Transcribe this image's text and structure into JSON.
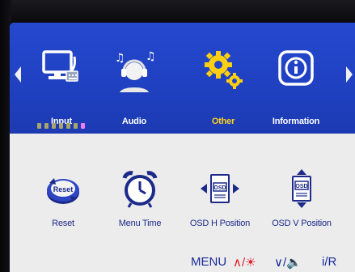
{
  "colors": {
    "band_blue": "#2246c9",
    "panel_gray": "#ececec",
    "label_white": "#ffffff",
    "label_selected": "#ffd21a",
    "sub_label_blue": "#1c2a8a",
    "key_blue": "#1a2b9a",
    "key_red": "#e0202a"
  },
  "categories": [
    {
      "label": "Input",
      "icon": "monitor-with-input-icon",
      "selected": false
    },
    {
      "label": "Audio",
      "icon": "headset-user-music-icon",
      "selected": false
    },
    {
      "label": "Other",
      "icon": "gears-icon",
      "selected": true
    },
    {
      "label": "Information",
      "icon": "info-icon",
      "selected": false
    }
  ],
  "page_indicator": {
    "count": 7,
    "active_index": 6
  },
  "sub_items": [
    {
      "label": "Reset",
      "icon": "reset-icon"
    },
    {
      "label": "Menu Time",
      "icon": "alarm-clock-icon"
    },
    {
      "label": "OSD H Position",
      "icon": "osd-horizontal-icon"
    },
    {
      "label": "OSD V Position",
      "icon": "osd-vertical-icon"
    }
  ],
  "key_hints": {
    "menu": "MENU",
    "up_brightness": "∧/☀",
    "down_volume": "∨/🔈",
    "info_r": "i/R"
  }
}
